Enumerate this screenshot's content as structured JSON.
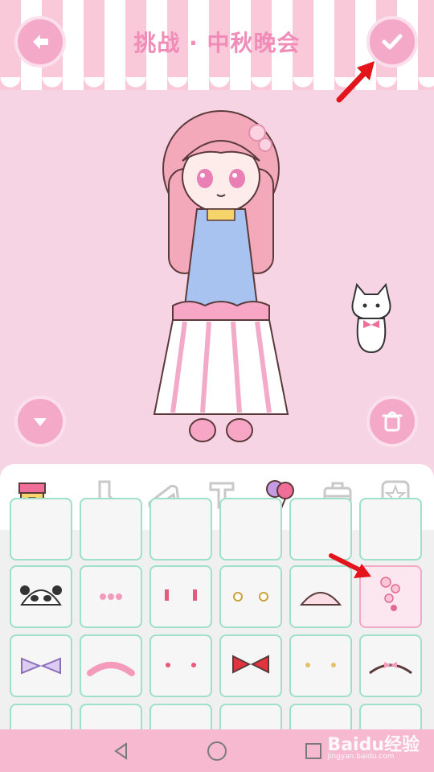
{
  "header": {
    "title": "挑战 · 中秋晚会"
  },
  "colors": {
    "accent": "#f5a9c8",
    "title": "#f18bb7",
    "cell_border": "#9ee0c9",
    "selected_border": "#f2a9c4",
    "annotation": "#e3141b"
  },
  "toolbar": {
    "back_icon": "back-arrow-icon",
    "confirm_icon": "checkmark-icon",
    "collapse_icon": "chevron-down-icon",
    "delete_icon": "trash-icon"
  },
  "tabs": [
    {
      "name": "shop",
      "icon": "shop-icon"
    },
    {
      "name": "socks",
      "icon": "sock-icon"
    },
    {
      "name": "shoes",
      "icon": "high-heel-icon"
    },
    {
      "name": "text",
      "icon": "text-t-icon"
    },
    {
      "name": "items",
      "icon": "balloons-icon",
      "active": true
    },
    {
      "name": "bag",
      "icon": "toolbox-icon"
    },
    {
      "name": "special",
      "icon": "star-icon"
    }
  ],
  "grid": {
    "rows": [
      [
        "partial-item",
        "partial-item",
        "partial-item",
        "partial-item",
        "partial-item",
        "partial-item"
      ],
      [
        "panda-hood",
        "flower-clip",
        "red-earrings",
        "gold-earrings",
        "pink-hat",
        "sakura-hairpin"
      ],
      [
        "purple-bow",
        "pink-headband",
        "red-studs",
        "red-bow",
        "gold-studs",
        "pink-headband-bow"
      ],
      [
        "partial-item",
        "partial-item",
        "partial-item",
        "partial-item",
        "partial-item",
        "partial-item"
      ]
    ],
    "selected": "sakura-hairpin"
  },
  "navbar": {
    "back": "nav-back-icon",
    "home": "nav-home-icon",
    "recent": "nav-recent-icon"
  },
  "watermark": {
    "brand": "Baidu经验",
    "url": "jingyan.baidu.com"
  }
}
